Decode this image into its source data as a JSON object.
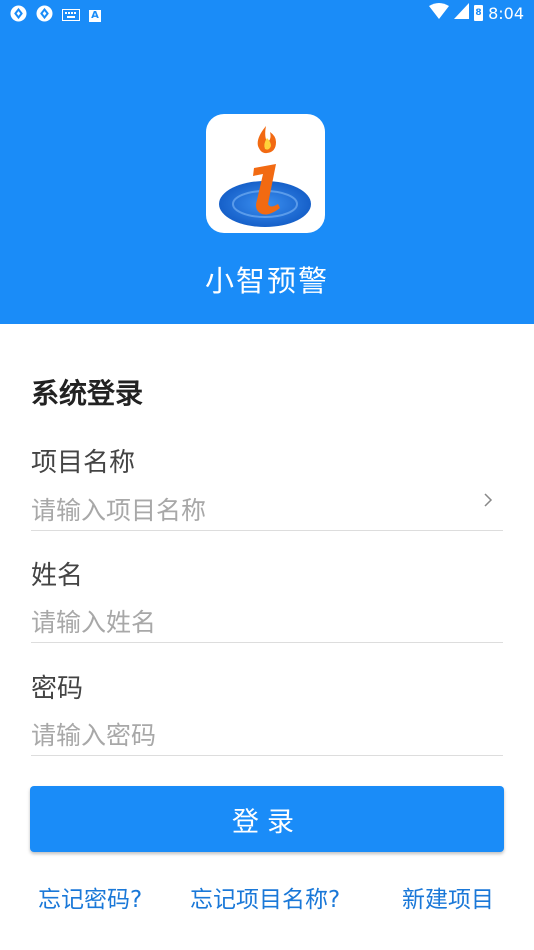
{
  "status_bar": {
    "time": "8:04",
    "left_icons": [
      "sync-icon",
      "sync-icon",
      "keyboard-icon",
      "a-badge-icon"
    ],
    "right_icons": [
      "wifi-icon",
      "signal-icon",
      "battery-icon"
    ],
    "a_badge": "A",
    "battery_charge": "8"
  },
  "header": {
    "app_name": "小智预警",
    "background_color": "#1a8cf8"
  },
  "form": {
    "title": "系统登录",
    "project": {
      "label": "项目名称",
      "placeholder": "请输入项目名称"
    },
    "name": {
      "label": "姓名",
      "placeholder": "请输入姓名"
    },
    "password": {
      "label": "密码",
      "placeholder": "请输入密码"
    },
    "login_label": "登录"
  },
  "links": {
    "forgot_password": "忘记密码?",
    "forgot_project": "忘记项目名称?",
    "new_project": "新建项目"
  },
  "colors": {
    "accent": "#1a8cf8",
    "link": "#1a78d8"
  }
}
